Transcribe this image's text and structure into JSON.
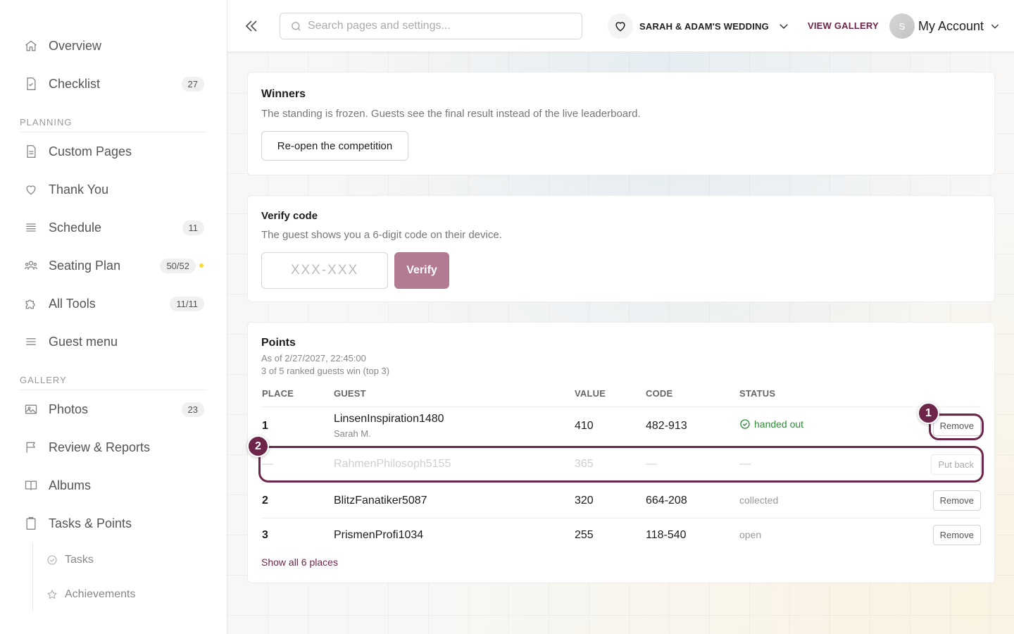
{
  "sidebar": {
    "items": [
      {
        "label": "Overview",
        "badge": null
      },
      {
        "label": "Checklist",
        "badge": "27"
      }
    ],
    "sections": [
      {
        "title": "PLANNING",
        "items": [
          {
            "label": "Custom Pages",
            "badge": null
          },
          {
            "label": "Thank You",
            "badge": null
          },
          {
            "label": "Schedule",
            "badge": "11"
          },
          {
            "label": "Seating Plan",
            "badge": "50/52"
          },
          {
            "label": "All Tools",
            "badge": "11/11"
          },
          {
            "label": "Guest menu",
            "badge": null
          }
        ]
      },
      {
        "title": "GALLERY",
        "items": [
          {
            "label": "Photos",
            "badge": "23"
          },
          {
            "label": "Review & Reports",
            "badge": null
          },
          {
            "label": "Albums",
            "badge": null
          },
          {
            "label": "Tasks & Points",
            "badge": null
          }
        ]
      }
    ],
    "sub_items": [
      {
        "label": "Tasks"
      },
      {
        "label": "Achievements"
      }
    ]
  },
  "topbar": {
    "search_placeholder": "Search pages and settings...",
    "event_name": "SARAH & ADAM'S WEDDING",
    "view_gallery": "VIEW GALLERY",
    "avatar_initial": "S",
    "account_label": "My Account"
  },
  "winners": {
    "title": "Winners",
    "description": "The standing is frozen. Guests see the final result instead of the live leaderboard.",
    "reopen_label": "Re-open the competition"
  },
  "verify": {
    "title": "Verify code",
    "description": "The guest shows you a 6-digit code on their device.",
    "code_placeholder": "XXX-XXX",
    "verify_label": "Verify"
  },
  "points": {
    "title": "Points",
    "as_of": "As of 2/27/2027, 22:45:00",
    "summary": "3 of 5 ranked guests win (top 3)",
    "columns": [
      "PLACE",
      "GUEST",
      "VALUE",
      "CODE",
      "STATUS"
    ],
    "rows": [
      {
        "place": "1",
        "guest": "LinsenInspiration1480",
        "guest_sub": "Sarah M.",
        "value": "410",
        "code": "482-913",
        "status": "handed out",
        "action": "Remove"
      },
      {
        "place": "—",
        "guest": "RahmenPhilosoph5155",
        "guest_sub": "",
        "value": "365",
        "code": "—",
        "status": "—",
        "action": "Put back"
      },
      {
        "place": "2",
        "guest": "BlitzFanatiker5087",
        "guest_sub": "",
        "value": "320",
        "code": "664-208",
        "status": "collected",
        "action": "Remove"
      },
      {
        "place": "3",
        "guest": "PrismenProfi1034",
        "guest_sub": "",
        "value": "255",
        "code": "118-540",
        "status": "open",
        "action": "Remove"
      }
    ],
    "show_all": "Show all 6 places"
  },
  "annotations": [
    {
      "number": "1"
    },
    {
      "number": "2"
    }
  ],
  "colors": {
    "accent": "#6d2649",
    "verify_button": "#b27a93",
    "status_ok": "#2e8b3a",
    "seating_dot": "#f5dc38"
  }
}
